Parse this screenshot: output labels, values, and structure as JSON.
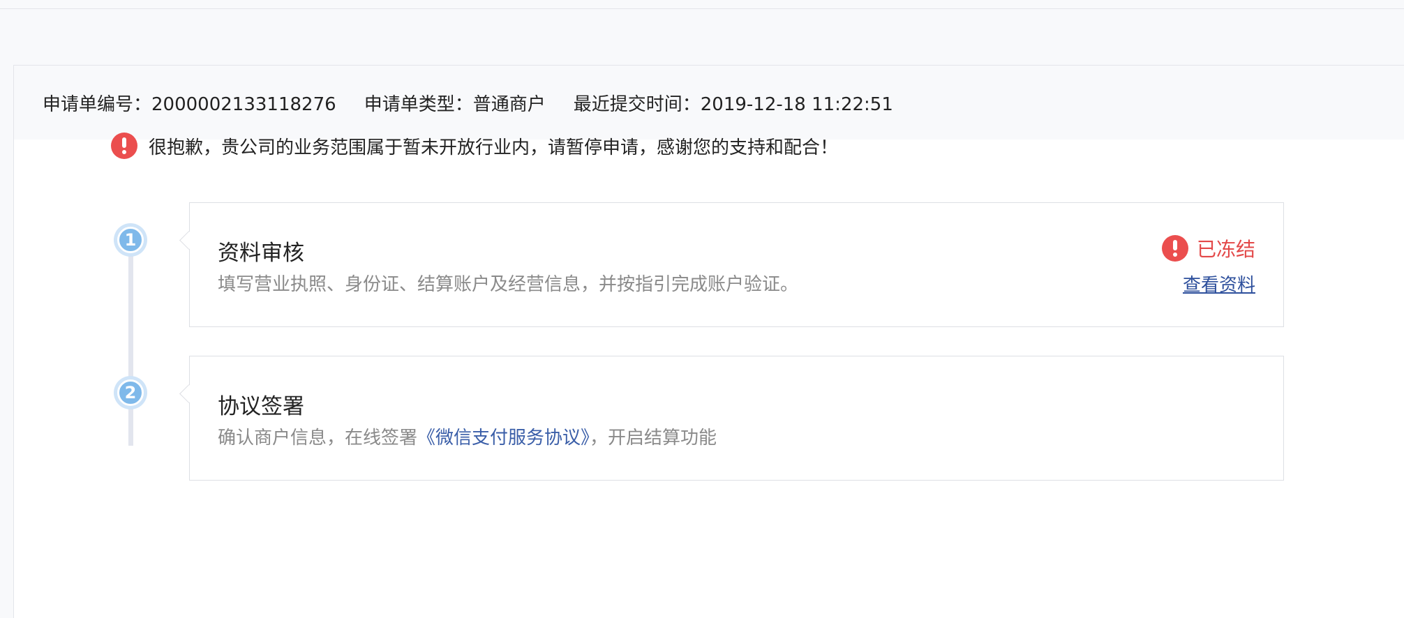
{
  "meta": {
    "application_no_label": "申请单编号：",
    "application_no": "2000002133118276",
    "application_type_label": "申请单类型：",
    "application_type": "普通商户",
    "last_submit_label": "最近提交时间：",
    "last_submit_time": "2019-12-18 11:22:51"
  },
  "notice": {
    "text": "很抱歉，贵公司的业务范围属于暂未开放行业内，请暂停申请，感谢您的支持和配合！",
    "icon": "alert-icon",
    "color": "#eb4e4e"
  },
  "steps": [
    {
      "number": "1",
      "title": "资料审核",
      "description": "填写营业执照、身份证、结算账户及经营信息，并按指引完成账户验证。",
      "status": "已冻结",
      "status_color": "#e34848",
      "action": "查看资料"
    },
    {
      "number": "2",
      "title": "协议签署",
      "description_before": "确认商户信息，在线签署",
      "description_link": "《微信支付服务协议》",
      "description_after": "，开启结算功能"
    }
  ],
  "colors": {
    "accent_link": "#3a5ea8",
    "step_badge": "#7fb9ea",
    "background": "#f8f9fb"
  }
}
